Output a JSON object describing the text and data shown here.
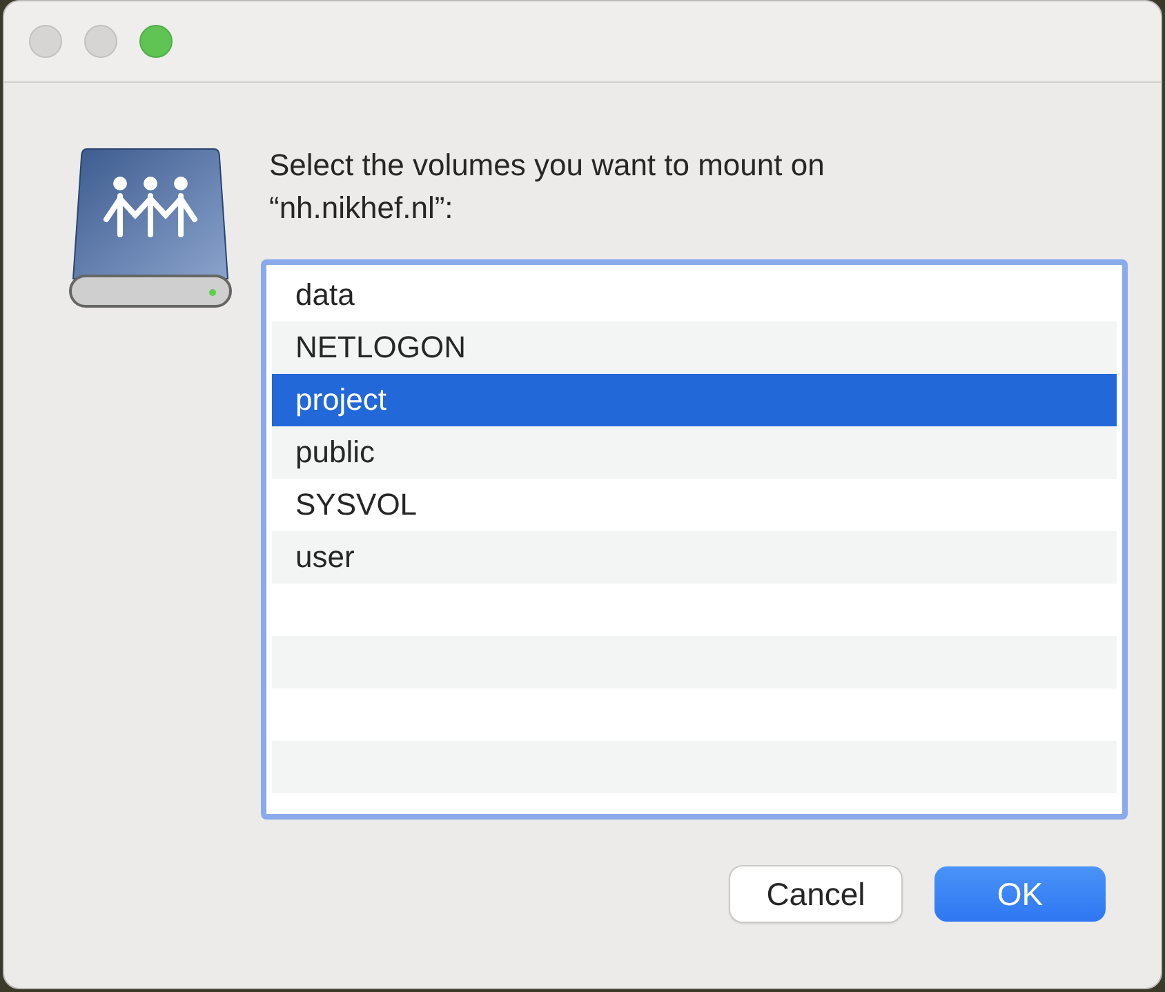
{
  "message": "Select the volumes you want to mount on “nh.nikhef.nl”:",
  "volumes": [
    {
      "name": "data",
      "selected": false
    },
    {
      "name": "NETLOGON",
      "selected": false
    },
    {
      "name": "project",
      "selected": true
    },
    {
      "name": "public",
      "selected": false
    },
    {
      "name": "SYSVOL",
      "selected": false
    },
    {
      "name": "user",
      "selected": false
    }
  ],
  "buttons": [
    {
      "label": "Cancel",
      "kind": "secondary"
    },
    {
      "label": "OK",
      "kind": "default"
    }
  ]
}
